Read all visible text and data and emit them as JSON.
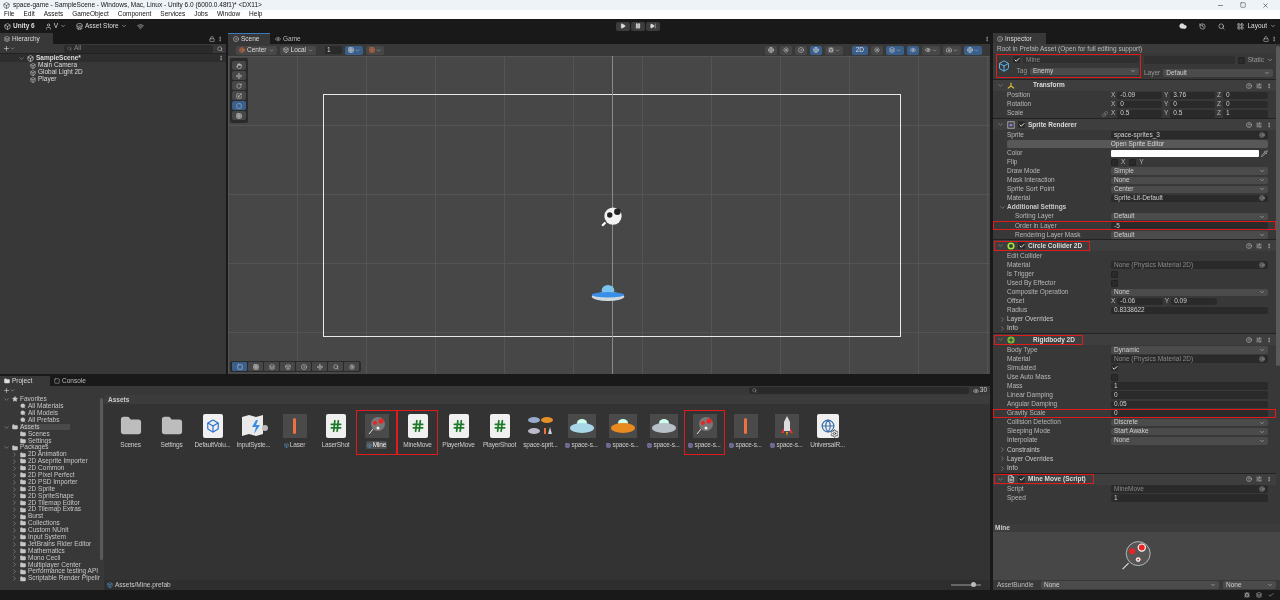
{
  "window": {
    "title": "space-game - SampleScene - Windows, Mac, Linux - Unity 6.0 (6000.0.48f1)* <DX11>"
  },
  "menu": [
    "File",
    "Edit",
    "Assets",
    "GameObject",
    "Component",
    "Services",
    "Jobs",
    "Window",
    "Help"
  ],
  "toolbar": {
    "account": "Unity 6",
    "user": "V",
    "store": "Asset Store",
    "layout": "Layout"
  },
  "hierarchy": {
    "tab": "Hierarchy",
    "search_placeholder": "All",
    "tree": [
      {
        "label": "SampleScene*",
        "expanded": true,
        "children": [
          {
            "label": "Main Camera"
          },
          {
            "label": "Global Light 2D"
          },
          {
            "label": "Player"
          }
        ]
      }
    ]
  },
  "scene": {
    "tabs": [
      {
        "label": "Scene",
        "selected": true
      },
      {
        "label": "Game",
        "selected": false
      }
    ],
    "pivot": "Center",
    "space": "Local",
    "snap": "1",
    "mode_2d": {
      "label": "2D",
      "selected": true
    }
  },
  "inspector": {
    "tab": "Inspector",
    "notice": "Root in Prefab Asset (Open for full editing support)",
    "object": {
      "name": "Mine",
      "active": true,
      "static_label": "Static",
      "static": false,
      "tag_label": "Tag",
      "tag": "Enemy",
      "layer_label": "Layer",
      "layer": "Default",
      "highlighted": true
    },
    "components": [
      {
        "kind": "transform",
        "title": "Transform",
        "highlighted": false,
        "rows": [
          {
            "kind": "vector",
            "label": "Position",
            "axes": [
              {
                "axis": "X",
                "value": "-0.09"
              },
              {
                "axis": "Y",
                "value": "3.76"
              },
              {
                "axis": "Z",
                "value": "0"
              }
            ]
          },
          {
            "kind": "vector",
            "label": "Rotation",
            "axes": [
              {
                "axis": "X",
                "value": "0"
              },
              {
                "axis": "Y",
                "value": "0"
              },
              {
                "axis": "Z",
                "value": "0"
              }
            ]
          },
          {
            "kind": "vector",
            "label": "Scale",
            "linked": true,
            "axes": [
              {
                "axis": "X",
                "value": "0.5"
              },
              {
                "axis": "Y",
                "value": "0.5"
              },
              {
                "axis": "Z",
                "value": "1"
              }
            ]
          }
        ]
      },
      {
        "kind": "sprite",
        "title": "Sprite Renderer",
        "enabled": true,
        "highlighted": false,
        "rows": [
          {
            "kind": "object",
            "label": "Sprite",
            "value": "space-sprites_3",
            "empty": false
          },
          {
            "kind": "button",
            "text": "Open Sprite Editor"
          },
          {
            "kind": "color",
            "label": "Color",
            "color": "#ffffff"
          },
          {
            "kind": "toggles",
            "label": "Flip",
            "toggles": [
              {
                "label": "X",
                "checked": false
              },
              {
                "label": "Y",
                "checked": false
              }
            ]
          },
          {
            "kind": "dropdown",
            "label": "Draw Mode",
            "value": "Simple"
          },
          {
            "kind": "dropdown",
            "label": "Mask Interaction",
            "value": "None"
          },
          {
            "kind": "dropdown",
            "label": "Sprite Sort Point",
            "value": "Center"
          },
          {
            "kind": "object",
            "label": "Material",
            "value": "Sprite-Lit-Default",
            "empty": false
          },
          {
            "kind": "foldout",
            "label": "Additional Settings",
            "expanded": true,
            "children": [
              {
                "kind": "dropdown",
                "label": "Sorting Layer",
                "value": "Default"
              },
              {
                "kind": "field",
                "label": "Order in Layer",
                "value": "-5",
                "highlighted": true
              },
              {
                "kind": "dropdown",
                "label": "Rendering Layer Mask",
                "value": "Default"
              }
            ]
          }
        ]
      },
      {
        "kind": "collider",
        "title": "Circle Collider 2D",
        "enabled": true,
        "highlighted": true,
        "rows": [
          {
            "kind": "label",
            "label": "Edit Collider"
          },
          {
            "kind": "object",
            "label": "Material",
            "value": "None (Physics Material 2D)",
            "empty": true
          },
          {
            "kind": "checkbox",
            "label": "Is Trigger",
            "checked": false
          },
          {
            "kind": "checkbox",
            "label": "Used By Effector",
            "checked": false
          },
          {
            "kind": "dropdown",
            "label": "Composite Operation",
            "value": "None"
          },
          {
            "kind": "vector",
            "label": "Offset",
            "axes": [
              {
                "axis": "X",
                "value": "-0.06"
              },
              {
                "axis": "Y",
                "value": "0.09"
              }
            ]
          },
          {
            "kind": "field",
            "label": "Radius",
            "value": "0.8338622"
          },
          {
            "kind": "foldout",
            "label": "Layer Overrides",
            "expanded": false
          },
          {
            "kind": "foldout",
            "label": "Info",
            "expanded": false
          }
        ]
      },
      {
        "kind": "rigidbody",
        "title": "Rigidbody 2D",
        "highlighted": true,
        "rows": [
          {
            "kind": "dropdown",
            "label": "Body Type",
            "value": "Dynamic"
          },
          {
            "kind": "object",
            "label": "Material",
            "value": "None (Physics Material 2D)",
            "empty": true
          },
          {
            "kind": "checkbox",
            "label": "Simulated",
            "checked": true
          },
          {
            "kind": "checkbox",
            "label": "Use Auto Mass",
            "checked": false
          },
          {
            "kind": "field",
            "label": "Mass",
            "value": "1"
          },
          {
            "kind": "field",
            "label": "Linear Damping",
            "value": "0"
          },
          {
            "kind": "field",
            "label": "Angular Damping",
            "value": "0.05"
          },
          {
            "kind": "field",
            "label": "Gravity Scale",
            "value": "0",
            "highlighted": true
          },
          {
            "kind": "dropdown",
            "label": "Collision Detection",
            "value": "Discrete"
          },
          {
            "kind": "dropdown",
            "label": "Sleeping Mode",
            "value": "Start Awake"
          },
          {
            "kind": "dropdown",
            "label": "Interpolate",
            "value": "None"
          },
          {
            "kind": "foldout",
            "label": "Constraints",
            "expanded": false
          },
          {
            "kind": "foldout",
            "label": "Layer Overrides",
            "expanded": false
          },
          {
            "kind": "foldout",
            "label": "Info",
            "expanded": false
          }
        ]
      },
      {
        "kind": "script",
        "title": "Mine Move (Script)",
        "enabled": true,
        "highlighted": true,
        "rows": [
          {
            "kind": "object",
            "label": "Script",
            "value": "MineMove",
            "empty": true
          },
          {
            "kind": "field",
            "label": "Speed",
            "value": "1"
          }
        ]
      }
    ],
    "preview": {
      "title": "Mine"
    },
    "asset_bundle": {
      "label": "AssetBundle",
      "name": "None",
      "variant": "None"
    }
  },
  "project": {
    "tabs": [
      {
        "label": "Project",
        "selected": true
      },
      {
        "label": "Console",
        "selected": false
      }
    ],
    "hidden_count": "30",
    "tree": [
      {
        "label": "Favorites",
        "kind": "favorites",
        "expanded": true,
        "selected": false,
        "children": [
          {
            "label": "All Materials",
            "kind": "search"
          },
          {
            "label": "All Models",
            "kind": "search"
          },
          {
            "label": "All Prefabs",
            "kind": "search"
          }
        ]
      },
      {
        "label": "Assets",
        "kind": "folder",
        "expanded": true,
        "selected": true,
        "children": [
          {
            "label": "Scenes",
            "kind": "folder"
          },
          {
            "label": "Settings",
            "kind": "folder"
          }
        ]
      },
      {
        "label": "Packages",
        "kind": "folder",
        "expanded": true,
        "selected": false,
        "children": [
          {
            "label": "2D Animation",
            "kind": "folder",
            "expanded": false
          },
          {
            "label": "2D Aseprite Importer",
            "kind": "folder",
            "expanded": false
          },
          {
            "label": "2D Common",
            "kind": "folder",
            "expanded": false
          },
          {
            "label": "2D Pixel Perfect",
            "kind": "folder",
            "expanded": false
          },
          {
            "label": "2D PSD Importer",
            "kind": "folder",
            "expanded": false
          },
          {
            "label": "2D Sprite",
            "kind": "folder",
            "expanded": false
          },
          {
            "label": "2D SpriteShape",
            "kind": "folder",
            "expanded": false
          },
          {
            "label": "2D Tilemap Editor",
            "kind": "folder",
            "expanded": false
          },
          {
            "label": "2D Tilemap Extras",
            "kind": "folder",
            "expanded": false
          },
          {
            "label": "Burst",
            "kind": "folder",
            "expanded": false
          },
          {
            "label": "Collections",
            "kind": "folder",
            "expanded": false
          },
          {
            "label": "Custom NUnit",
            "kind": "folder",
            "expanded": false
          },
          {
            "label": "Input System",
            "kind": "folder",
            "expanded": false
          },
          {
            "label": "JetBrains Rider Editor",
            "kind": "folder",
            "expanded": false
          },
          {
            "label": "Mathematics",
            "kind": "folder",
            "expanded": false
          },
          {
            "label": "Mono Cecil",
            "kind": "folder",
            "expanded": false
          },
          {
            "label": "Multiplayer Center",
            "kind": "folder",
            "expanded": false
          },
          {
            "label": "Performance testing API",
            "kind": "folder",
            "expanded": false
          },
          {
            "label": "Scriptable Render Pipelin",
            "kind": "folder",
            "expanded": false
          }
        ]
      }
    ],
    "breadcrumb": "Assets",
    "assets": [
      {
        "label": "Scenes",
        "kind": "folder",
        "selected": false,
        "highlighted": false
      },
      {
        "label": "Settings",
        "kind": "folder",
        "selected": false,
        "highlighted": false
      },
      {
        "label": "DefaultVolu...",
        "kind": "volume",
        "selected": false,
        "highlighted": false
      },
      {
        "label": "InputSyste...",
        "kind": "input",
        "selected": false,
        "highlighted": false
      },
      {
        "label": "Laser",
        "kind": "laser",
        "badge": {
          "kind": "prefab"
        },
        "selected": false,
        "highlighted": false
      },
      {
        "label": "LaserShot",
        "kind": "script",
        "selected": false,
        "highlighted": false
      },
      {
        "label": "Mine",
        "kind": "mine",
        "badge": {
          "kind": "prefab"
        },
        "selected": true,
        "highlighted": true
      },
      {
        "label": "MineMove",
        "kind": "script",
        "selected": false,
        "highlighted": true
      },
      {
        "label": "PlayerMove",
        "kind": "script",
        "selected": false,
        "highlighted": false
      },
      {
        "label": "PlayerShoot",
        "kind": "script",
        "selected": false,
        "highlighted": false
      },
      {
        "label": "space-sprit...",
        "kind": "sheet",
        "selected": false,
        "highlighted": false
      },
      {
        "label": "space-s...",
        "kind": "ufo",
        "badge": {
          "kind": "sprite"
        },
        "selected": false,
        "highlighted": false
      },
      {
        "label": "space-s...",
        "kind": "ufo2",
        "badge": {
          "kind": "sprite"
        },
        "selected": false,
        "highlighted": false
      },
      {
        "label": "space-s...",
        "kind": "ufo3",
        "badge": {
          "kind": "sprite"
        },
        "selected": false,
        "highlighted": false
      },
      {
        "label": "space-s...",
        "kind": "mine",
        "badge": {
          "kind": "sprite"
        },
        "selected": false,
        "highlighted": true
      },
      {
        "label": "space-s...",
        "kind": "laser",
        "badge": {
          "kind": "sprite"
        },
        "selected": false,
        "highlighted": false
      },
      {
        "label": "space-s...",
        "kind": "rocket",
        "badge": {
          "kind": "sprite"
        },
        "selected": false,
        "highlighted": false
      },
      {
        "label": "UniversalR...",
        "kind": "pipeline",
        "selected": false,
        "highlighted": false
      }
    ],
    "path": "Assets/Mine.prefab",
    "icon_size": {
      "level": 0.75
    }
  }
}
